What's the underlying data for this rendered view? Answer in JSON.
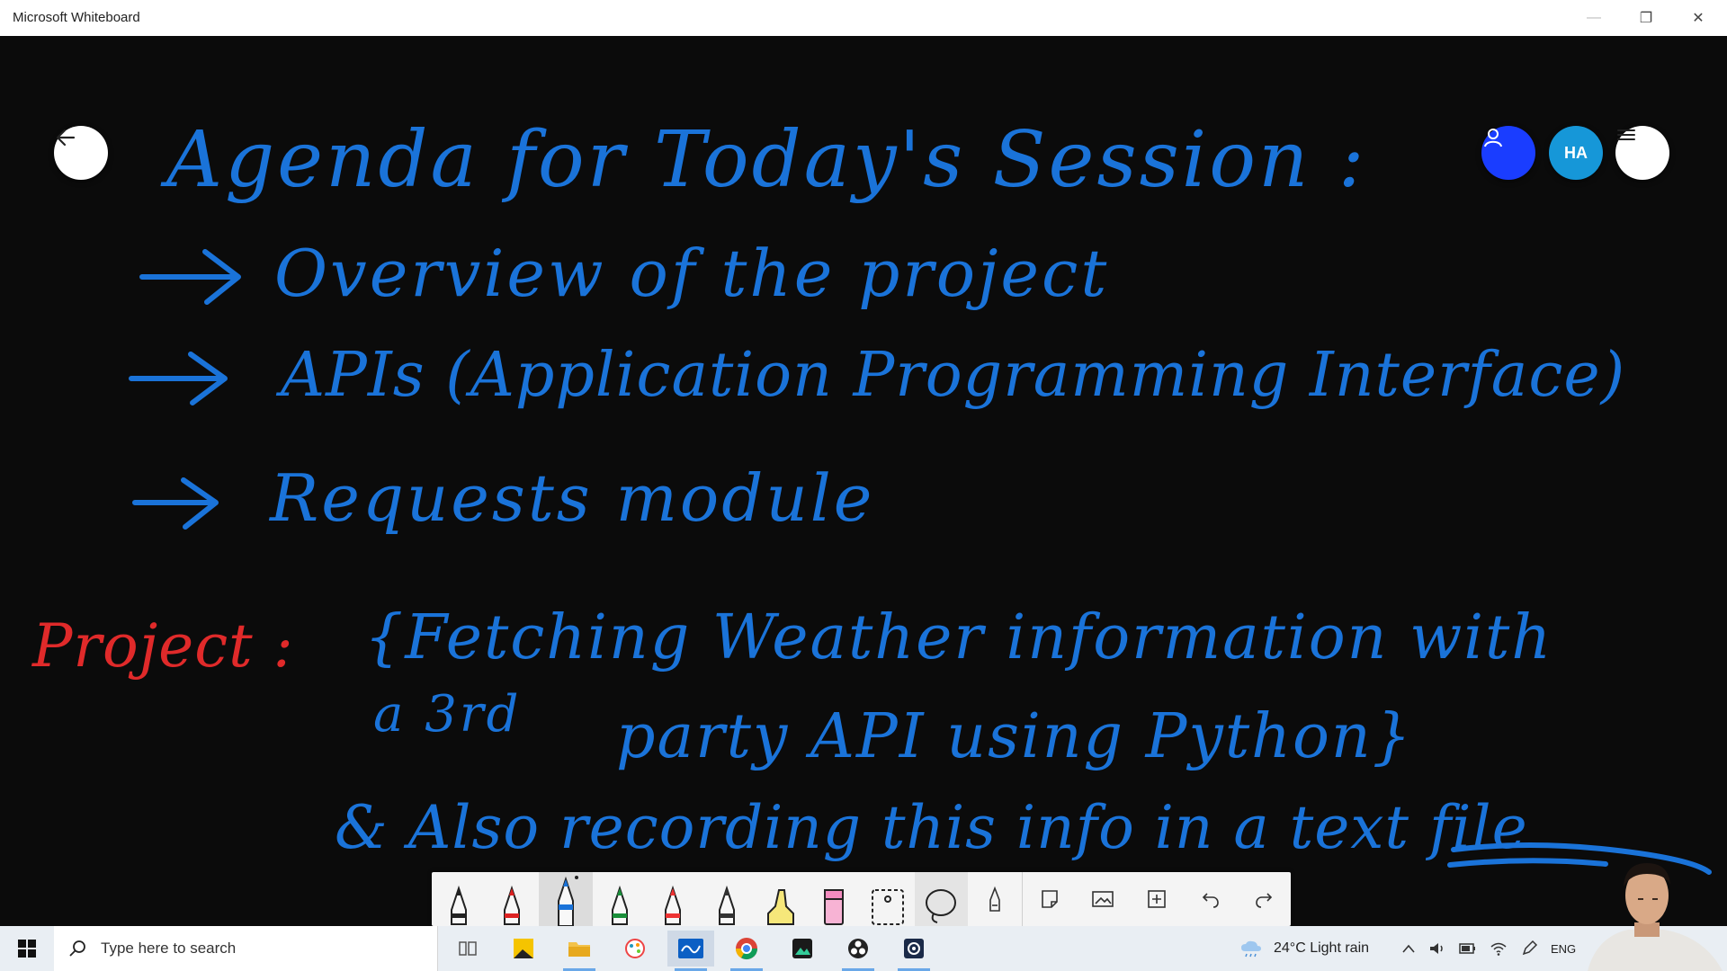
{
  "window": {
    "title": "Microsoft Whiteboard",
    "controls": {
      "minimize": "—",
      "restore": "❐",
      "close": "✕"
    }
  },
  "whiteboard": {
    "heading": "Agenda for Today's Session :",
    "agenda_items": [
      "Overview of the project",
      "APIs (Application Programming Interface)",
      "Requests module"
    ],
    "project_label": "Project :",
    "project_lines": [
      "{Fetching Weather information with",
      "a 3rd",
      "party API using Python}",
      "& Also recording this info in a text file"
    ],
    "ink_colors": {
      "blue": "#1a73d9",
      "red": "#e02a2a"
    }
  },
  "top_buttons": {
    "back": "back-arrow-icon",
    "user": "person-icon",
    "avatar_initials": "HA",
    "menu": "hamburger-menu-icon"
  },
  "toolbar": {
    "tools": [
      "pen-white",
      "pen-red",
      "pen-blue",
      "pen-green",
      "pen-red-2",
      "pen-dark",
      "highlighter-yellow",
      "highlighter-pink",
      "eraser",
      "lasso",
      "ruler",
      "sticky-note",
      "image",
      "insert",
      "undo",
      "redo"
    ],
    "selected_tool": "pen-blue"
  },
  "taskbar": {
    "search_placeholder": "Type here to search",
    "weather": "24°C  Light rain",
    "language": "ENG"
  }
}
